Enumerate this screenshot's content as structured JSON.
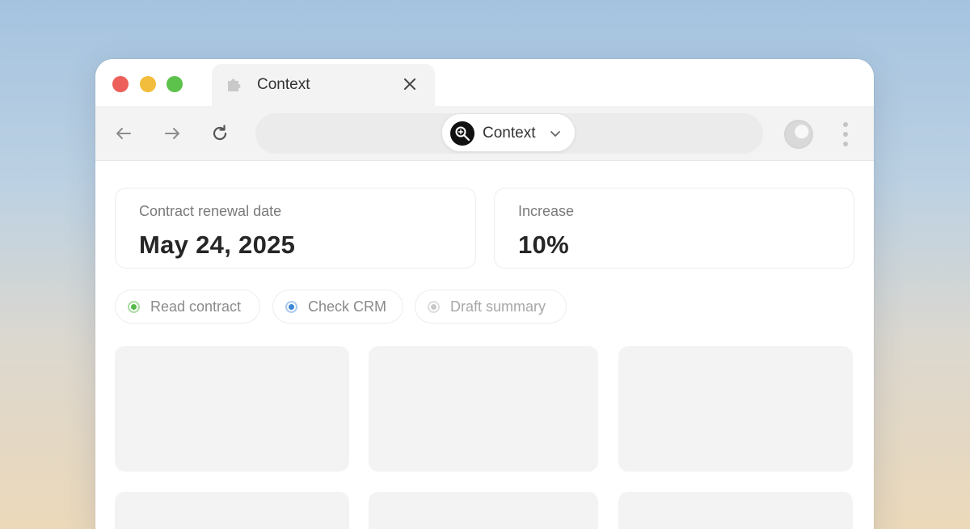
{
  "browser": {
    "tab": {
      "title": "Context",
      "icon": "puzzle-icon"
    },
    "nav": {
      "back_icon": "arrow-left-icon",
      "forward_icon": "arrow-right-icon",
      "reload_icon": "reload-icon"
    },
    "address": {
      "chip_label": "Context",
      "chip_icon": "context-logo-icon"
    },
    "profile_icon": "profile-avatar-icon",
    "menu_icon": "kebab-menu-icon"
  },
  "cards": [
    {
      "label": "Contract renewal date",
      "value": "May 24, 2025"
    },
    {
      "label": "Increase",
      "value": "10%"
    }
  ],
  "steps": [
    {
      "label": "Read contract",
      "status": "done",
      "color": "#55b94a"
    },
    {
      "label": "Check CRM",
      "status": "active",
      "color": "#3d86d6"
    },
    {
      "label": "Draft summary",
      "status": "pending",
      "color": "#c8c8c8"
    }
  ],
  "colors": {
    "traffic_red": "#ec5f5a",
    "traffic_yellow": "#f2bd3c",
    "traffic_green": "#5cc24c",
    "toolbar_bg": "#f3f3f3",
    "placeholder_tile": "#f3f3f3"
  }
}
